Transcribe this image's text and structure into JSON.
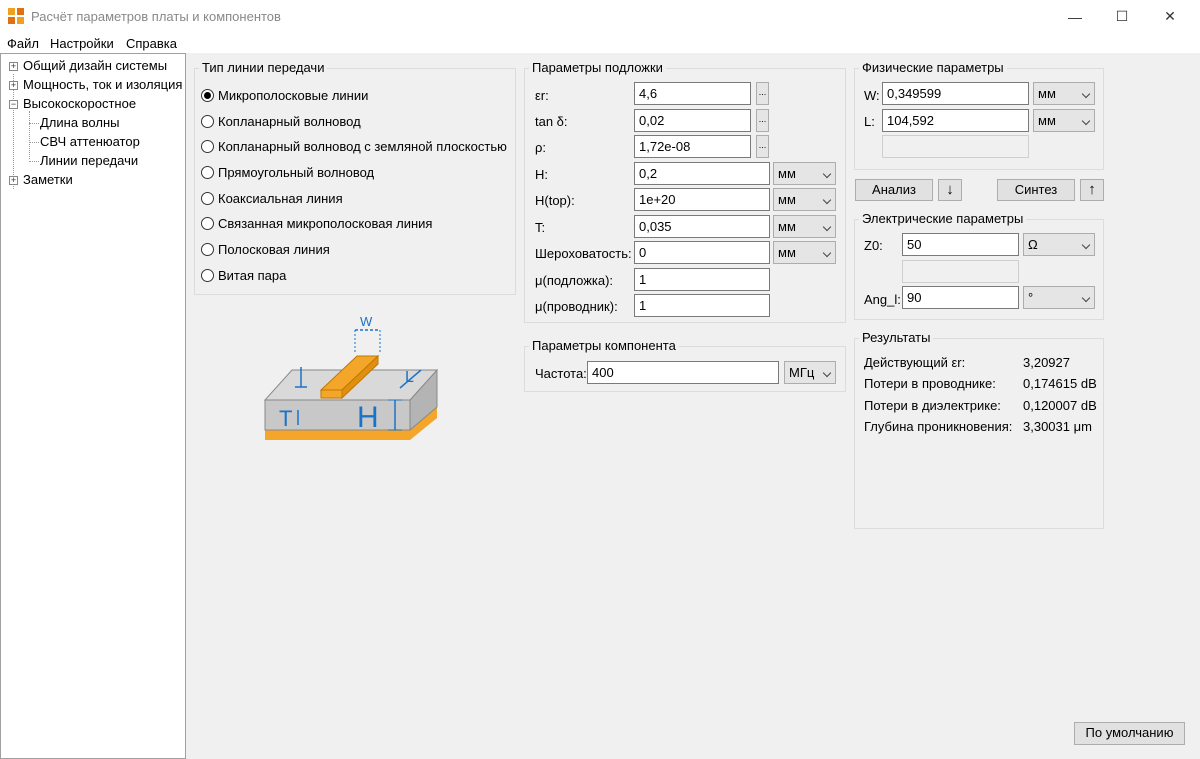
{
  "window": {
    "title": "Расчёт параметров платы и компонентов",
    "minimize": "—",
    "maximize": "☐",
    "close": "✕"
  },
  "menu": [
    "Файл",
    "Настройки",
    "Справка"
  ],
  "tree": {
    "items": [
      "Общий дизайн системы",
      "Мощность, ток и изоляция",
      "Высокоскоростное",
      "Длина волны",
      "СВЧ аттенюатор",
      "Линии передачи",
      "Заметки"
    ],
    "expand_plus": "+",
    "expand_minus": "−"
  },
  "line_type": {
    "title": "Тип линии передачи",
    "options": [
      "Микрополосковые линии",
      "Копланарный волновод",
      "Копланарный волновод с земляной плоскостью",
      "Прямоугольный волновод",
      "Коаксиальная линия",
      "Связанная микрополосковая линия",
      "Полосковая линия",
      "Витая пара"
    ],
    "selected_index": 0
  },
  "substrate": {
    "title": "Параметры подложки",
    "rows": [
      {
        "label": "εr:",
        "value": "4,6",
        "dots": "..."
      },
      {
        "label": "tan δ:",
        "value": "0,02",
        "dots": "..."
      },
      {
        "label": "ρ:",
        "value": "1,72e-08",
        "dots": "..."
      },
      {
        "label": "H:",
        "value": "0,2",
        "unit": "мм"
      },
      {
        "label": "H(top):",
        "value": "1e+20",
        "unit": "мм"
      },
      {
        "label": "T:",
        "value": "0,035",
        "unit": "мм"
      },
      {
        "label": "Шероховатость:",
        "value": "0",
        "unit": "мм"
      },
      {
        "label": "μ(подложка):",
        "value": "1"
      },
      {
        "label": "μ(проводник):",
        "value": "1"
      }
    ]
  },
  "component": {
    "title": "Параметры компонента",
    "freq_label": "Частота:",
    "freq_value": "400",
    "freq_unit": "МГц"
  },
  "physical": {
    "title": "Физические параметры",
    "w_label": "W:",
    "w_value": "0,349599",
    "w_unit": "мм",
    "l_label": "L:",
    "l_value": "104,592",
    "l_unit": "мм"
  },
  "actions": {
    "analyze": "Анализ",
    "synthesize": "Синтез",
    "down_arrow": "↓",
    "up_arrow": "↑"
  },
  "electrical": {
    "title": "Электрические параметры",
    "z0_label": "Z0:",
    "z0_value": "50",
    "z0_unit": "Ω",
    "ang_label": "Ang_l:",
    "ang_value": "90",
    "ang_unit": "°"
  },
  "results": {
    "title": "Результаты",
    "rows": [
      {
        "label": "Действующий εr:",
        "value": "3,20927"
      },
      {
        "label": "Потери в проводнике:",
        "value": "0,174615 dB"
      },
      {
        "label": "Потери в диэлектрике:",
        "value": "0,120007 dB"
      },
      {
        "label": "Глубина проникновения:",
        "value": "3,30031 μm"
      }
    ]
  },
  "diagram": {
    "w": "W",
    "l": "L",
    "t": "T",
    "h": "H"
  },
  "defaults_button": "По умолчанию",
  "colors": {
    "copper": "#f4a62a",
    "substrate": "#c8c8c8",
    "substrate_top": "#d9d9d9",
    "dimension": "#1a73c8"
  }
}
